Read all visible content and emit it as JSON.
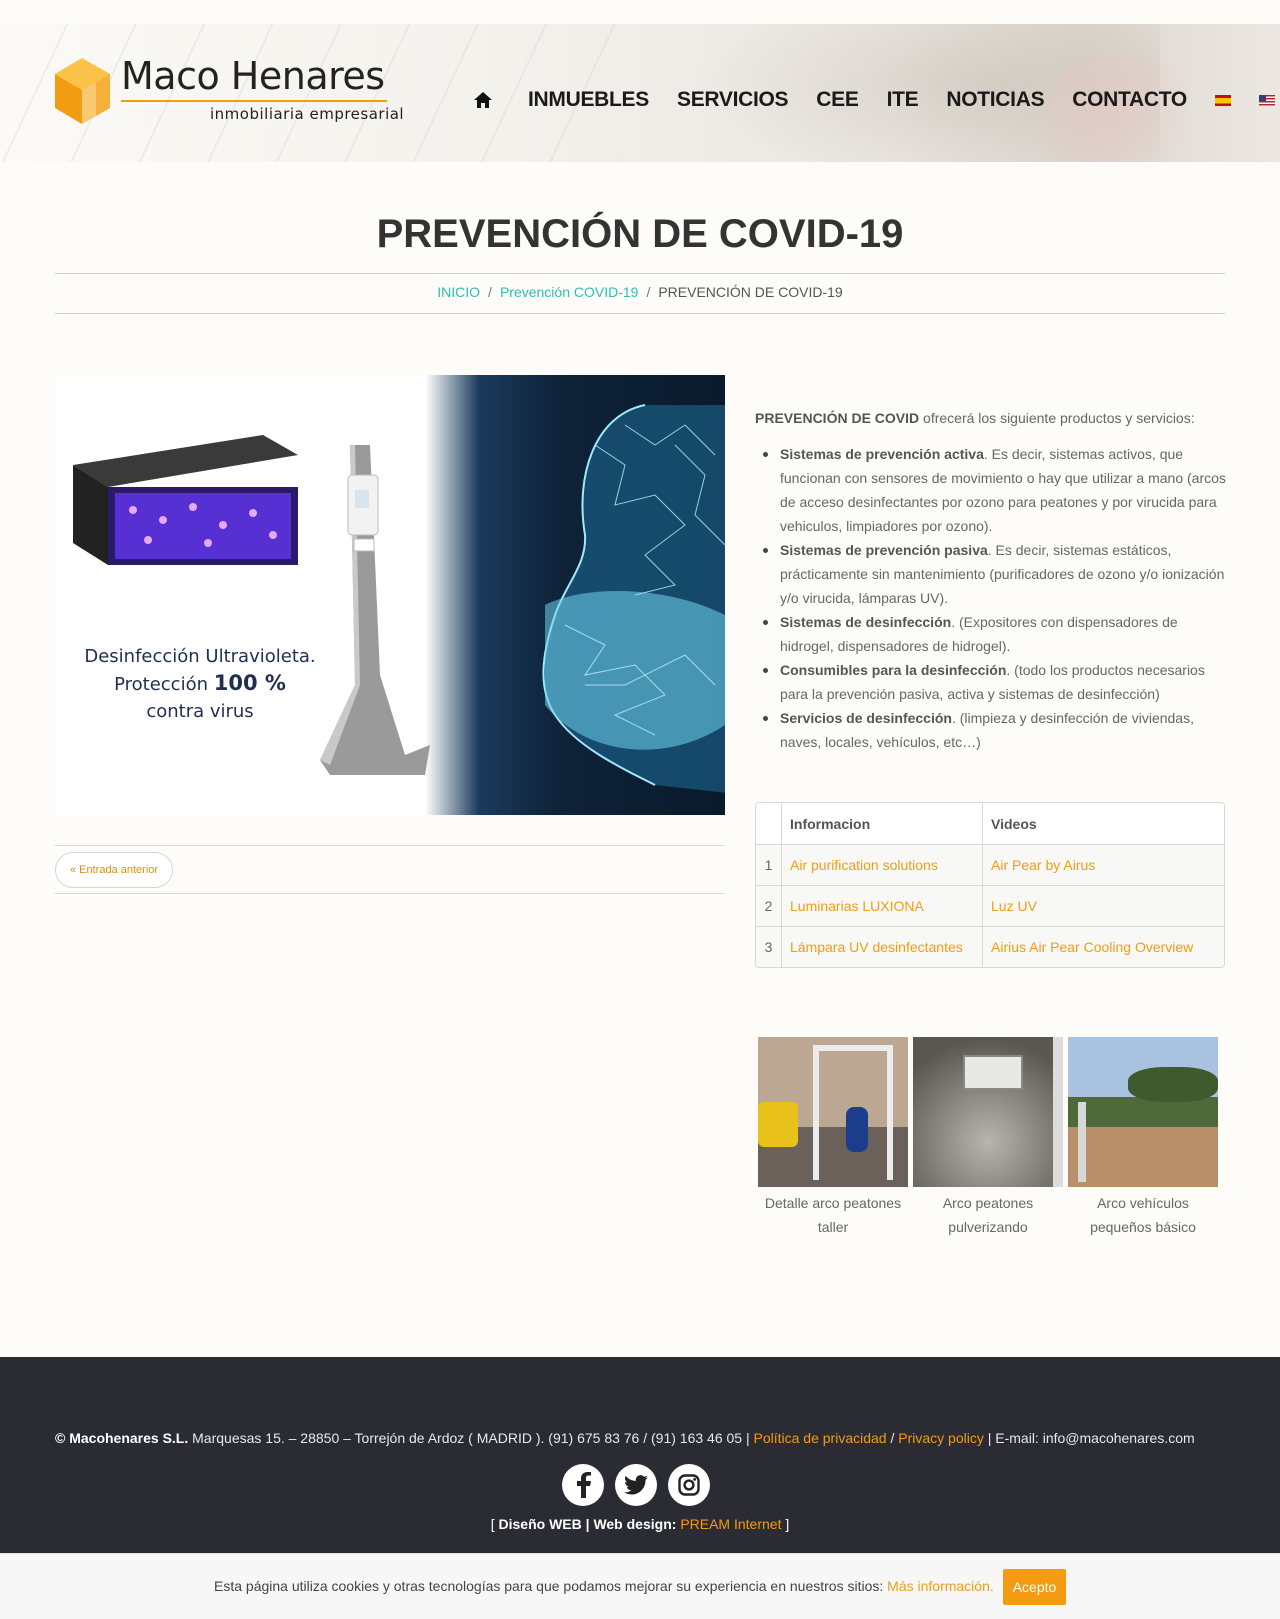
{
  "header": {
    "logo": {
      "name": "Maco Henares",
      "tagline": "inmobiliaria empresarial"
    },
    "nav": {
      "home_icon": "home-icon",
      "items": [
        "INMUEBLES",
        "SERVICIOS",
        "CEE",
        "ITE",
        "NOTICIAS",
        "CONTACTO"
      ],
      "flags": [
        "flag-es",
        "flag-us"
      ]
    }
  },
  "page": {
    "title": "PREVENCIÓN DE COVID-19",
    "breadcrumb": {
      "home": "INICIO",
      "sep": "/",
      "category": "Prevención COVID-19",
      "current": "PREVENCIÓN DE COVID-19"
    }
  },
  "hero": {
    "line1": "Desinfección Ultravioleta.",
    "line2a": "Protección ",
    "line2b": "100 %",
    "line3": "contra virus"
  },
  "prev_button": "« Entrada anterior",
  "content": {
    "intro_bold": "PREVENCIÓN DE COVID",
    "intro_rest": " ofrecerá los siguiente productos y servicios:",
    "bullets": [
      {
        "bold": "Sistemas de prevención activa",
        "text": ". Es decir, sistemas activos, que funcionan con sensores de movimiento o hay que utilizar a mano (arcos de acceso desinfectantes por ozono para peatones y por virucida para vehiculos, limpiadores por ozono)."
      },
      {
        "bold": "Sistemas de prevención pasiva",
        "text": ". Es decir, sistemas estáticos, prácticamente sin mantenimiento (purificadores de ozono y/o ionización y/o virucida, lámparas UV)."
      },
      {
        "bold": "Sistemas de desinfección",
        "text": ". (Expositores con dispensadores de hidrogel, dispensadores de hidrogel)."
      },
      {
        "bold": "Consumibles para la desinfección",
        "text": ". (todo los productos necesarios para la prevención pasiva, activa y sistemas de desinfección)"
      },
      {
        "bold": "Servicios de desinfección",
        "text": ". (limpieza y desinfección de viviendas, naves, locales, vehículos, etc…)"
      }
    ],
    "table": {
      "headers": [
        "",
        "Informacion",
        "Videos"
      ],
      "rows": [
        [
          "1",
          "Air purification solutions",
          "Air Pear by Airus"
        ],
        [
          "2",
          "Luminarias LUXIONA",
          "Luz UV"
        ],
        [
          "3",
          "Lámpara UV desinfectantes",
          "Airius Air Pear Cooling Overview"
        ]
      ]
    },
    "gallery": [
      {
        "caption": "Detalle arco peatones taller"
      },
      {
        "caption": "Arco peatones pulverizando"
      },
      {
        "caption": "Arco vehículos pequeños básico"
      }
    ]
  },
  "footer": {
    "company": "© Macohenares S.L.",
    "address": " Marquesas 15. – 28850 – Torrejón de Ardoz ( MADRID ). (91) 675 83 76 / (91) 163 46 05 | ",
    "privacy_es": "Política de privacidad",
    "slash": " / ",
    "privacy_en": "Privacy policy",
    "email": " | E-mail: info@macohenares.com",
    "socials": [
      "facebook-icon",
      "twitter-icon",
      "instagram-icon"
    ],
    "credit_open": "[ ",
    "credit_bold": "Diseño WEB | Web design:",
    "credit_link": "PREAM Internet",
    "credit_close": " ]"
  },
  "cookie": {
    "text": "Esta página utiliza cookies y otras tecnologías para que podamos mejorar su experiencia en nuestros sitios: ",
    "link": "Más información.",
    "button": "Acepto"
  },
  "colors": {
    "accent": "#f39c12",
    "teal": "#2fbfb0",
    "footer_bg": "#2b2b34"
  }
}
